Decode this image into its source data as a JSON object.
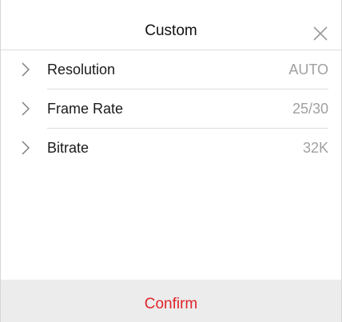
{
  "dialog": {
    "title": "Custom"
  },
  "options": [
    {
      "label": "Resolution",
      "value": "AUTO"
    },
    {
      "label": "Frame Rate",
      "value": "25/30"
    },
    {
      "label": "Bitrate",
      "value": "32K"
    }
  ],
  "footer": {
    "confirm_label": "Confirm"
  },
  "colors": {
    "accent": "#e0242b",
    "footer_bg": "#ececec",
    "value_text": "#a0a0a0"
  },
  "icons": {
    "close": "close-icon",
    "row_chevron": "chevron-right-icon"
  }
}
